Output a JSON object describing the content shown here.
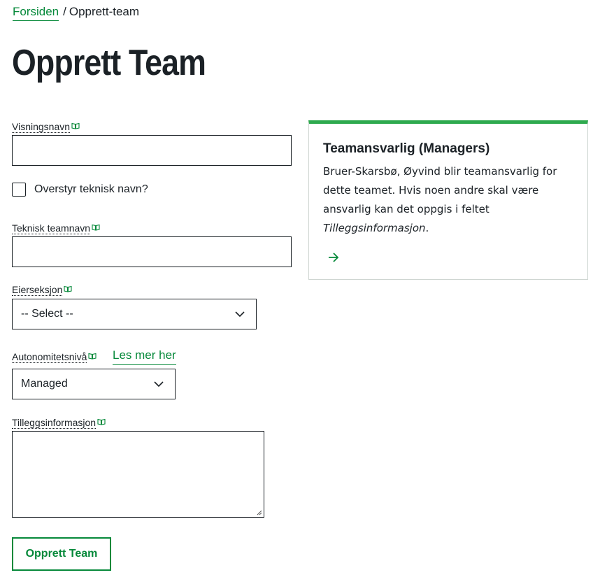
{
  "breadcrumb": {
    "home": "Forsiden",
    "separator": "/",
    "current": "Opprett-team"
  },
  "page": {
    "title": "Opprett Team"
  },
  "form": {
    "display_name": {
      "label": "Visningsnavn",
      "value": ""
    },
    "override": {
      "label": "Overstyr teknisk navn?",
      "checked": false
    },
    "technical_name": {
      "label": "Teknisk teamnavn",
      "value": ""
    },
    "owner_section": {
      "label": "Eierseksjon",
      "selected": "-- Select --"
    },
    "autonomy": {
      "label": "Autonomitetsnivå",
      "link": "Les mer her",
      "selected": "Managed"
    },
    "additional_info": {
      "label": "Tilleggsinformasjon",
      "value": ""
    },
    "submit_label": "Opprett Team"
  },
  "info_card": {
    "title": "Teamansvarlig (Managers)",
    "body": "Bruer-Skarsbø, Øyvind blir teamansvarlig for dette teamet. Hvis noen andre skal være ansvarlig kan det oppgis i feltet ",
    "body_emphasis": "Tilleggsinformasjon",
    "body_end": "."
  },
  "icons": {
    "help": "book-icon",
    "select": "chevron-down-icon",
    "card_link": "arrow-right-icon"
  },
  "colors": {
    "accent": "#06893a",
    "card_border_top": "#2eaa4e",
    "text": "#1b2126"
  }
}
